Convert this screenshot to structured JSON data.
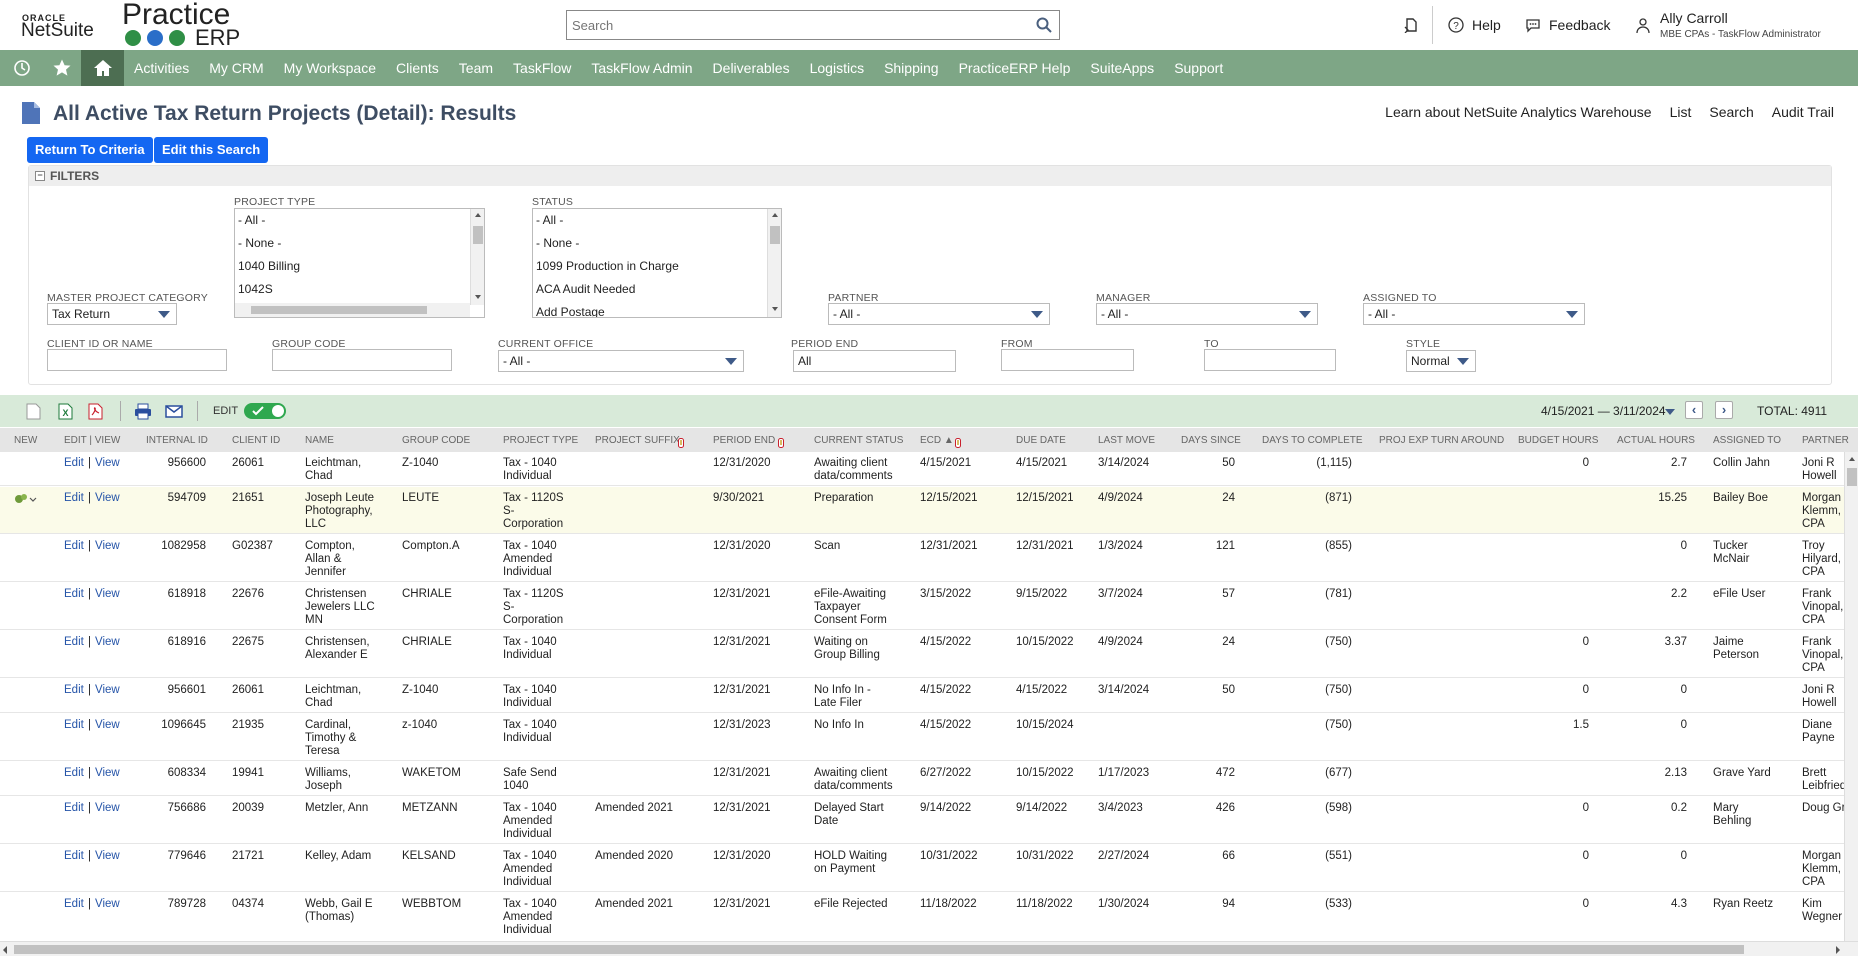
{
  "header": {
    "oracle": "ORACLE",
    "netsuite": "NetSuite",
    "practice": "Practice",
    "erp": "ERP",
    "search_placeholder": "Search",
    "help": "Help",
    "feedback": "Feedback",
    "user_name": "Ally Carroll",
    "user_role": "MBE CPAs - TaskFlow Administrator"
  },
  "nav": [
    "Activities",
    "My CRM",
    "My Workspace",
    "Clients",
    "Team",
    "TaskFlow",
    "TaskFlow Admin",
    "Deliverables",
    "Logistics",
    "Shipping",
    "PracticeERP Help",
    "SuiteApps",
    "Support"
  ],
  "page": {
    "title": "All Active Tax Return Projects (Detail): Results",
    "links": [
      "Learn about NetSuite Analytics Warehouse",
      "List",
      "Search",
      "Audit Trail"
    ],
    "return_btn": "Return To Criteria",
    "edit_btn": "Edit this Search"
  },
  "filters": {
    "header": "FILTERS",
    "master_label": "MASTER PROJECT CATEGORY",
    "master_value": "Tax Return",
    "project_type_label": "PROJECT TYPE",
    "project_type_options": [
      "- All -",
      "- None -",
      "1040 Billing",
      "1042S"
    ],
    "status_label": "STATUS",
    "status_options": [
      "- All -",
      "- None -",
      "1099 Production in Charge",
      "ACA Audit Needed",
      "Add Postage"
    ],
    "partner_label": "PARTNER",
    "partner_value": "- All -",
    "manager_label": "MANAGER",
    "manager_value": "- All -",
    "assigned_label": "ASSIGNED TO",
    "assigned_value": "- All -",
    "client_label": "CLIENT ID OR NAME",
    "group_label": "GROUP CODE",
    "office_label": "CURRENT OFFICE",
    "office_value": "- All -",
    "period_label": "PERIOD END",
    "period_value": "All",
    "from_label": "FROM",
    "to_label": "TO",
    "style_label": "STYLE",
    "style_value": "Normal"
  },
  "toolbar": {
    "edit_label": "EDIT",
    "date_range": "4/15/2021 — 3/11/2024",
    "total": "TOTAL: 4911"
  },
  "columns": [
    "NEW",
    "EDIT | VIEW",
    "INTERNAL ID",
    "CLIENT ID",
    "NAME",
    "GROUP CODE",
    "PROJECT TYPE",
    "PROJECT SUFFIX",
    "PERIOD END",
    "CURRENT STATUS",
    "ECD ▲",
    "DUE DATE",
    "LAST MOVE",
    "DAYS SINCE",
    "DAYS TO COMPLETE",
    "PROJ EXP TURN AROUND",
    "BUDGET HOURS",
    "ACTUAL HOURS",
    "ASSIGNED TO",
    "PARTNER"
  ],
  "rows": [
    {
      "iid": "956600",
      "cid": "26061",
      "name": [
        "Leichtman,",
        "Chad"
      ],
      "group": "Z-1040",
      "ptype": [
        "Tax - 1040",
        "Individual"
      ],
      "suffix": "",
      "pend": "12/31/2020",
      "status": [
        "Awaiting client",
        "data/comments"
      ],
      "ecd": "4/15/2021",
      "due": "4/15/2021",
      "last": "3/14/2024",
      "since": "50",
      "dtc": "(1,115)",
      "budget": "0",
      "actual": "2.7",
      "assigned": [
        "Collin Jahn"
      ],
      "partner": [
        "Joni R",
        "Howell"
      ]
    },
    {
      "iid": "594709",
      "cid": "21651",
      "name": [
        "Joseph Leute",
        "Photography,",
        "LLC"
      ],
      "group": "LEUTE",
      "ptype": [
        "Tax - 1120S",
        "S-",
        "Corporation"
      ],
      "suffix": "",
      "pend": "9/30/2021",
      "status": [
        "Preparation"
      ],
      "ecd": "12/15/2021",
      "due": "12/15/2021",
      "last": "4/9/2024",
      "since": "24",
      "dtc": "(871)",
      "budget": "",
      "actual": "15.25",
      "assigned": [
        "Bailey Boe"
      ],
      "partner": [
        "Morgan",
        "Klemm,",
        "CPA"
      ]
    },
    {
      "iid": "1082958",
      "cid": "G02387",
      "name": [
        "Compton,",
        "Allan &",
        "Jennifer"
      ],
      "group": "Compton.A",
      "ptype": [
        "Tax - 1040",
        "Amended",
        "Individual"
      ],
      "suffix": "",
      "pend": "12/31/2020",
      "status": [
        "Scan"
      ],
      "ecd": "12/31/2021",
      "due": "12/31/2021",
      "last": "1/3/2024",
      "since": "121",
      "dtc": "(855)",
      "budget": "",
      "actual": "0",
      "assigned": [
        "Tucker",
        "McNair"
      ],
      "partner": [
        "Troy",
        "Hilyard,",
        "CPA"
      ]
    },
    {
      "iid": "618918",
      "cid": "22676",
      "name": [
        "Christensen",
        "Jewelers LLC",
        "MN"
      ],
      "group": "CHRIALE",
      "ptype": [
        "Tax - 1120S",
        "S-",
        "Corporation"
      ],
      "suffix": "",
      "pend": "12/31/2021",
      "status": [
        "eFile-Awaiting",
        "Taxpayer",
        "Consent Form"
      ],
      "ecd": "3/15/2022",
      "due": "9/15/2022",
      "last": "3/7/2024",
      "since": "57",
      "dtc": "(781)",
      "budget": "",
      "actual": "2.2",
      "assigned": [
        "eFile User"
      ],
      "partner": [
        "Frank",
        "Vinopal,",
        "CPA"
      ]
    },
    {
      "iid": "618916",
      "cid": "22675",
      "name": [
        "Christensen,",
        "Alexander E"
      ],
      "group": "CHRIALE",
      "ptype": [
        "Tax - 1040",
        "Individual"
      ],
      "suffix": "",
      "pend": "12/31/2021",
      "status": [
        "Waiting on",
        "Group Billing"
      ],
      "ecd": "4/15/2022",
      "due": "10/15/2022",
      "last": "4/9/2024",
      "since": "24",
      "dtc": "(750)",
      "budget": "0",
      "actual": "3.37",
      "assigned": [
        "Jaime",
        "Peterson"
      ],
      "partner": [
        "Frank",
        "Vinopal,",
        "CPA"
      ]
    },
    {
      "iid": "956601",
      "cid": "26061",
      "name": [
        "Leichtman,",
        "Chad"
      ],
      "group": "Z-1040",
      "ptype": [
        "Tax - 1040",
        "Individual"
      ],
      "suffix": "",
      "pend": "12/31/2021",
      "status": [
        "No Info In -",
        "Late Filer"
      ],
      "ecd": "4/15/2022",
      "due": "4/15/2022",
      "last": "3/14/2024",
      "since": "50",
      "dtc": "(750)",
      "budget": "0",
      "actual": "0",
      "assigned": [],
      "partner": [
        "Joni R",
        "Howell"
      ]
    },
    {
      "iid": "1096645",
      "cid": "21935",
      "name": [
        "Cardinal,",
        "Timothy &",
        "Teresa"
      ],
      "group": "z-1040",
      "ptype": [
        "Tax - 1040",
        "Individual"
      ],
      "suffix": "",
      "pend": "12/31/2023",
      "status": [
        "No Info In"
      ],
      "ecd": "4/15/2022",
      "due": "10/15/2024",
      "last": "",
      "since": "",
      "dtc": "(750)",
      "budget": "1.5",
      "actual": "0",
      "assigned": [],
      "partner": [
        "Diane",
        "Payne"
      ]
    },
    {
      "iid": "608334",
      "cid": "19941",
      "name": [
        "Williams,",
        "Joseph"
      ],
      "group": "WAKETOM",
      "ptype": [
        "Safe Send",
        "1040"
      ],
      "suffix": "",
      "pend": "12/31/2021",
      "status": [
        "Awaiting client",
        "data/comments"
      ],
      "ecd": "6/27/2022",
      "due": "10/15/2022",
      "last": "1/17/2023",
      "since": "472",
      "dtc": "(677)",
      "budget": "",
      "actual": "2.13",
      "assigned": [
        "Grave Yard"
      ],
      "partner": [
        "Brett",
        "Leibfried"
      ]
    },
    {
      "iid": "756686",
      "cid": "20039",
      "name": [
        "Metzler, Ann"
      ],
      "group": "METZANN",
      "ptype": [
        "Tax - 1040",
        "Amended",
        "Individual"
      ],
      "suffix": "Amended 2021",
      "pend": "12/31/2021",
      "status": [
        "Delayed Start",
        "Date"
      ],
      "ecd": "9/14/2022",
      "due": "9/14/2022",
      "last": "3/4/2023",
      "since": "426",
      "dtc": "(598)",
      "budget": "0",
      "actual": "0.2",
      "assigned": [
        "Mary",
        "Behling"
      ],
      "partner": [
        "Doug Gr"
      ]
    },
    {
      "iid": "779646",
      "cid": "21721",
      "name": [
        "Kelley, Adam"
      ],
      "group": "KELSAND",
      "ptype": [
        "Tax - 1040",
        "Amended",
        "Individual"
      ],
      "suffix": "Amended 2020",
      "pend": "12/31/2020",
      "status": [
        "HOLD Waiting",
        "on Payment"
      ],
      "ecd": "10/31/2022",
      "due": "10/31/2022",
      "last": "2/27/2024",
      "since": "66",
      "dtc": "(551)",
      "budget": "0",
      "actual": "0",
      "assigned": [],
      "partner": [
        "Morgan",
        "Klemm,",
        "CPA"
      ]
    },
    {
      "iid": "789728",
      "cid": "04374",
      "name": [
        "Webb, Gail E",
        "(Thomas)"
      ],
      "group": "WEBBTOM",
      "ptype": [
        "Tax - 1040",
        "Amended",
        "Individual"
      ],
      "suffix": "Amended 2021",
      "pend": "12/31/2021",
      "status": [
        "eFile Rejected"
      ],
      "ecd": "11/18/2022",
      "due": "11/18/2022",
      "last": "1/30/2024",
      "since": "94",
      "dtc": "(533)",
      "budget": "0",
      "actual": "4.3",
      "assigned": [
        "Ryan Reetz"
      ],
      "partner": [
        "Kim",
        "Wegner"
      ]
    }
  ],
  "edit_link": "Edit",
  "view_link": "View",
  "colors": {
    "nav": "#7ea686",
    "nav_home": "#4d6e52",
    "button": "#1467f2",
    "title": "#3e4d63",
    "link": "#2554a8",
    "toolbar": "#d8ead9"
  }
}
